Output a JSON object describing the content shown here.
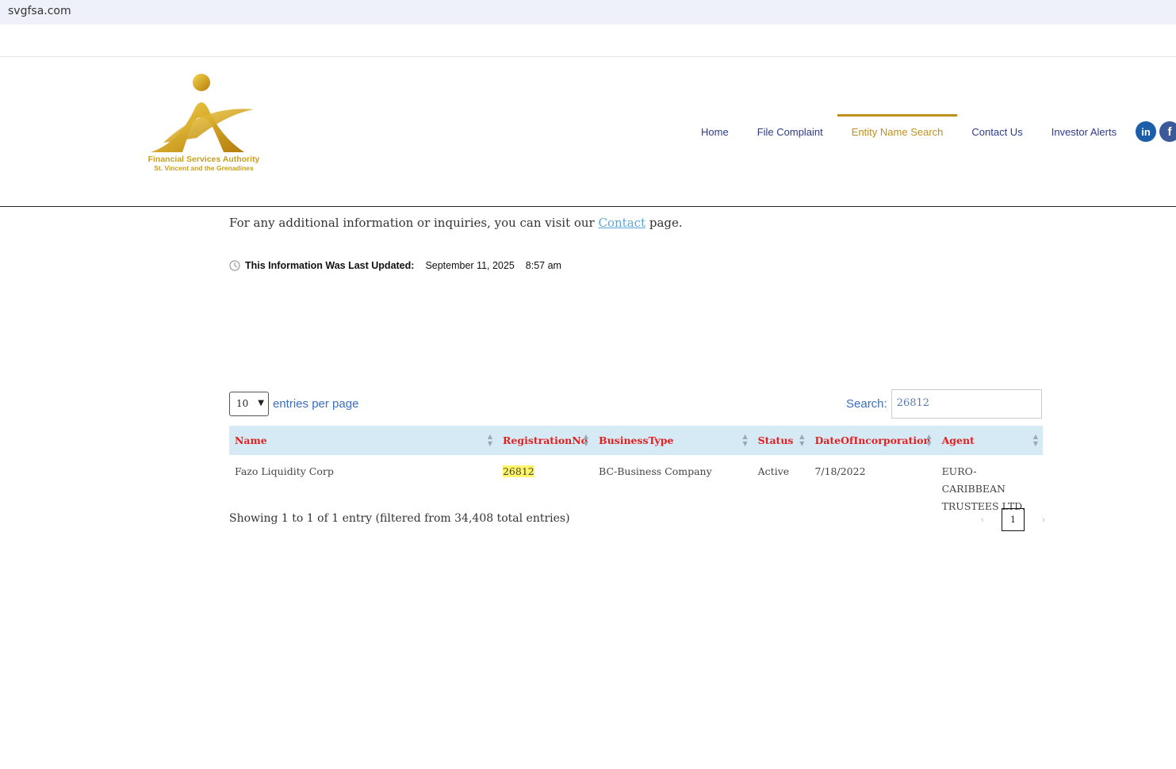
{
  "browser": {
    "url": "svgfsa.com"
  },
  "logo": {
    "name": "Financial Services Authority",
    "subtitle": "St. Vincent and the Grenadines"
  },
  "nav": {
    "items": [
      {
        "label": "Home",
        "active": false
      },
      {
        "label": "File Complaint",
        "active": false
      },
      {
        "label": "Entity Name Search",
        "active": true
      },
      {
        "label": "Contact Us",
        "active": false
      },
      {
        "label": "Investor Alerts",
        "active": false
      }
    ],
    "social": [
      {
        "icon": "linkedin-icon",
        "glyph": "in"
      },
      {
        "icon": "facebook-icon",
        "glyph": "f"
      }
    ]
  },
  "info": {
    "prefix": "For any additional information or inquiries, you can visit our ",
    "link": "Contact",
    "suffix": " page."
  },
  "updated": {
    "label": "This Information Was Last Updated:",
    "date": "September 11, 2025",
    "time": "8:57 am"
  },
  "table_controls": {
    "entries_value": "10",
    "entries_label": "entries per page",
    "search_label": "Search:",
    "search_value": "26812"
  },
  "table": {
    "columns": [
      "Name",
      "RegistrationNo",
      "BusinessType",
      "Status",
      "DateOfIncorporation",
      "Agent"
    ],
    "rows": [
      {
        "name": "Fazo Liquidity Corp",
        "registration_no": "26812",
        "business_type": "BC-Business Company",
        "status": "Active",
        "date": "7/18/2022",
        "agent": "EURO-CARIBBEAN TRUSTEES LTD."
      }
    ]
  },
  "summary": "Showing 1 to 1 of 1 entry (filtered from 34,408 total entries)",
  "pagination": {
    "prev": "‹",
    "current": "1",
    "next": "›"
  },
  "colors": {
    "gold": "#c0911a",
    "nav": "#2e3a8c",
    "header_red": "#e22020",
    "table_header_bg": "#d5eaf4"
  }
}
